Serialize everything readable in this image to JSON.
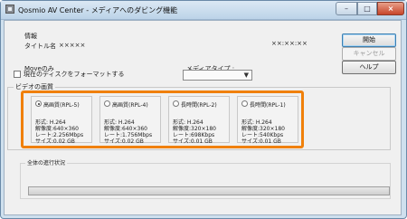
{
  "window": {
    "title": "Qosmio AV Center - メディアへのダビング機能",
    "min_label": "–",
    "max_label": "□",
    "close_label": "×"
  },
  "info": {
    "section_label": "情報",
    "title_label": "タイトル名",
    "title_value": "×××××",
    "duration": "××:××:××",
    "move_label": "Moveのみ",
    "media_type_label": "メディアタイプ :",
    "disk_space_label": "ディスクの空き容量 :"
  },
  "buttons": {
    "start": "開始",
    "cancel": "キャンセル",
    "help": "ヘルプ"
  },
  "format": {
    "checkbox_label": "現在のディスクをフォーマットする",
    "checked": false,
    "dropdown_value": ""
  },
  "quality": {
    "group_label": "ビデオの画質",
    "options": [
      {
        "name": "高画質(RPL-5)",
        "selected": true,
        "format": "形式: H.264",
        "resolution": "解像度:640×360",
        "rate": "レート:2.256Mbps",
        "size": "サイズ:0.02 GB"
      },
      {
        "name": "高画質(RPL-4)",
        "selected": false,
        "format": "形式: H.264",
        "resolution": "解像度:640×360",
        "rate": "レート:1.756Mbps",
        "size": "サイズ:0.02 GB"
      },
      {
        "name": "長時間(RPL-2)",
        "selected": false,
        "format": "形式: H.264",
        "resolution": "解像度:320×180",
        "rate": "レート:698Kbps",
        "size": "サイズ:0.01 GB"
      },
      {
        "name": "長時間(RPL-1)",
        "selected": false,
        "format": "形式: H.264",
        "resolution": "解像度:320×180",
        "rate": "レート:540Kbps",
        "size": "サイズ:0.01 GB"
      }
    ]
  },
  "progress": {
    "label": "全体の進行状況",
    "fraction": 0
  },
  "colors": {
    "highlight": "#f0800a",
    "accent": "#3c7fb1"
  }
}
